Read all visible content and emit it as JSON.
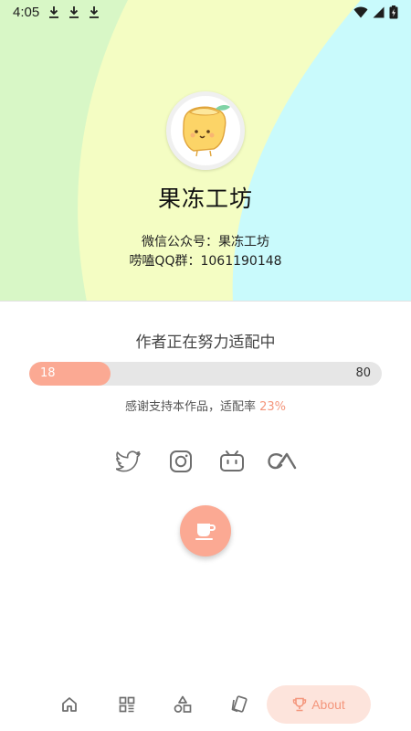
{
  "status_bar": {
    "time": "4:05",
    "download_icons": [
      "download-icon",
      "download-icon",
      "download-icon"
    ],
    "right_icons": [
      "wifi-icon",
      "signal-icon",
      "battery-charging-icon"
    ]
  },
  "profile": {
    "avatar_icon": "jelly-mascot-icon",
    "name": "果冻工坊",
    "wechat_line": "微信公众号：果冻工坊",
    "qq_line": "唠嗑QQ群：1061190148"
  },
  "adaptation": {
    "title": "作者正在努力适配中",
    "progress_min": "18",
    "progress_max": "80",
    "progress_fraction": 0.23,
    "thanks_text": "感谢支持本作品，适配率",
    "percent_text": "23%"
  },
  "social_icons": [
    "twitter-icon",
    "instagram-icon",
    "bilibili-icon",
    "coolapk-icon"
  ],
  "fab": {
    "icon": "coffee-cup-icon"
  },
  "bottom_nav": {
    "items": [
      {
        "icon": "home-icon"
      },
      {
        "icon": "grid-icon"
      },
      {
        "icon": "shapes-icon"
      },
      {
        "icon": "cards-icon"
      },
      {
        "icon": "trophy-icon",
        "label": "About",
        "active": true
      }
    ]
  },
  "colors": {
    "accent": "#fba993",
    "accent_text": "#f4967c",
    "active_tab_bg": "#fde4dc",
    "bg_green": "#d8f7c6",
    "bg_yellow": "#f7ffc4",
    "bg_cyan": "#c9fafc"
  }
}
